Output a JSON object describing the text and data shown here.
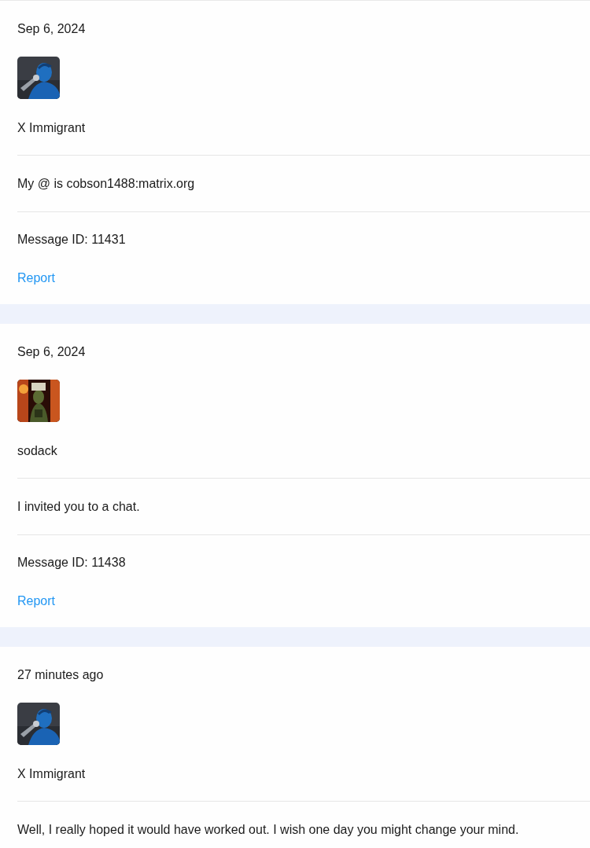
{
  "messages": [
    {
      "date": "Sep 6, 2024",
      "author": "X Immigrant",
      "body": "My @ is cobson1488:matrix.org",
      "message_id": "Message ID: 11431",
      "report": "Report"
    },
    {
      "date": "Sep 6, 2024",
      "author": "sodack",
      "body": "I invited you to a chat.",
      "message_id": "Message ID: 11438",
      "report": "Report"
    },
    {
      "date": "27 minutes ago",
      "author": "X Immigrant",
      "body": "Well, I really hoped it would have worked out. I wish one day you might change your mind."
    }
  ]
}
